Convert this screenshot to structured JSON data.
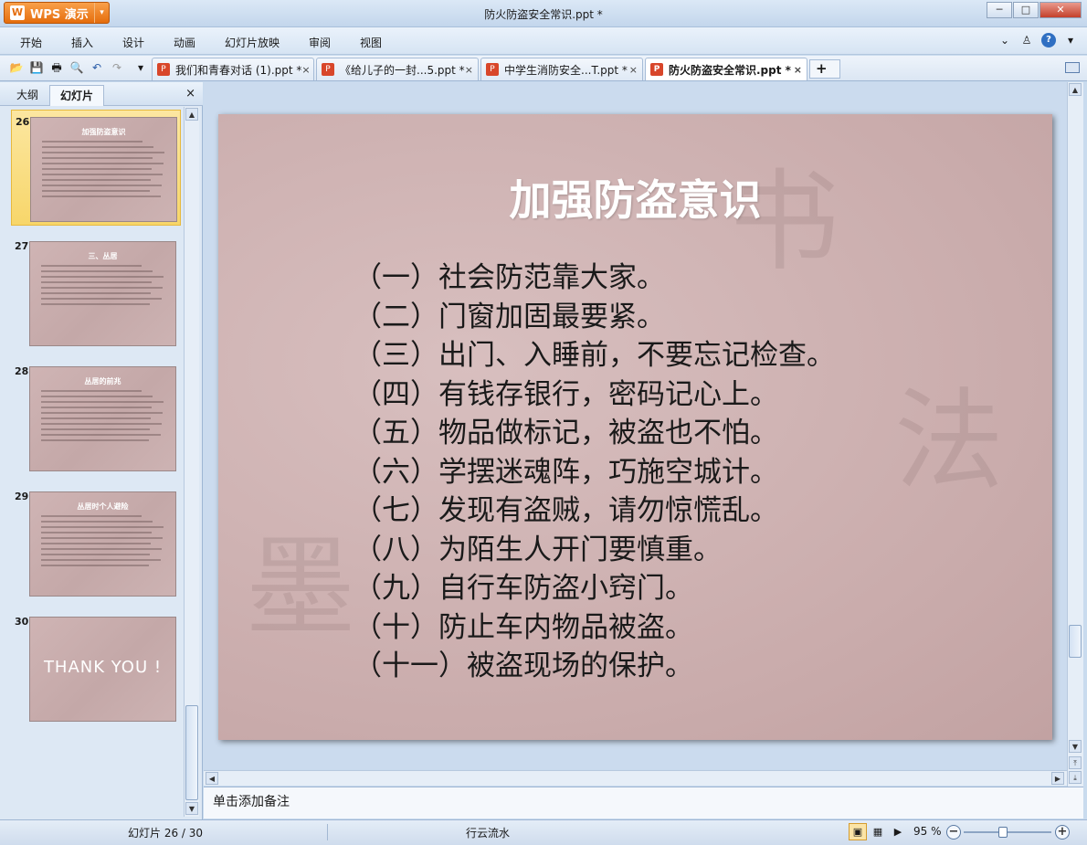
{
  "app": {
    "name": "WPS 演示",
    "logo_glyph": "W",
    "dropdown_glyph": "▾"
  },
  "window": {
    "title": "防火防盗安全常识.ppt *",
    "minimize_glyph": "─",
    "maximize_glyph": "□",
    "close_glyph": "✕"
  },
  "menu": {
    "items": [
      "开始",
      "插入",
      "设计",
      "动画",
      "幻灯片放映",
      "审阅",
      "视图"
    ],
    "right_icons": {
      "collapse": "⌄",
      "skin": "♙",
      "help": "?",
      "help_drop": "▾"
    }
  },
  "quick_access": {
    "open": "📂",
    "save": "💾",
    "print": "🖶",
    "preview": "🔍",
    "undo": "↶",
    "redo": "↷",
    "more": "▾"
  },
  "doc_tabs": [
    {
      "label": "我们和青春对话 (1).ppt *",
      "close": "×",
      "icon": "P"
    },
    {
      "label": "《给儿子的一封...5.ppt *",
      "close": "×",
      "icon": "P"
    },
    {
      "label": "中学生消防安全...T.ppt *",
      "close": "×",
      "icon": "P"
    },
    {
      "label": "防火防盗安全常识.ppt *",
      "close": "×",
      "icon": "P"
    }
  ],
  "new_tab": {
    "plus": "+",
    "drop": "▾"
  },
  "left_panel": {
    "tabs": [
      "大纲",
      "幻灯片"
    ],
    "close": "×",
    "thumbnails": [
      {
        "number": "26",
        "title": "加强防盗意识",
        "lines": 11
      },
      {
        "number": "27",
        "title": "三、丛居",
        "lines": 8
      },
      {
        "number": "28",
        "title": "丛居的前兆",
        "lines": 10
      },
      {
        "number": "29",
        "title": "丛居时个人避险",
        "lines": 10
      },
      {
        "number": "30",
        "title": "THANK YOU !",
        "lines": 0
      }
    ]
  },
  "slide": {
    "title": "加强防盗意识",
    "lines": [
      "（一）社会防范靠大家。",
      "（二）门窗加固最要紧。",
      "（三）出门、入睡前，不要忘记检查。",
      "（四）有钱存银行，密码记心上。",
      "（五）物品做标记，被盗也不怕。",
      "（六）学摆迷魂阵，巧施空城计。",
      "（七）发现有盗贼，请勿惊慌乱。",
      "（八）为陌生人开门要慎重。",
      "（九）自行车防盗小窍门。",
      "（十）防止车内物品被盗。",
      "（十一）被盗现场的保护。"
    ]
  },
  "scroll": {
    "up": "▲",
    "down": "▼",
    "left": "◀",
    "right": "▶",
    "page_up": "⤒",
    "page_down": "⤓"
  },
  "notes": {
    "placeholder": "单击添加备注"
  },
  "status": {
    "slide_counter": "幻灯片 26 / 30",
    "theme": "行云流水",
    "zoom": "95 %",
    "zoom_minus": "−",
    "zoom_plus": "+",
    "zoom_fraction": 0.45
  }
}
